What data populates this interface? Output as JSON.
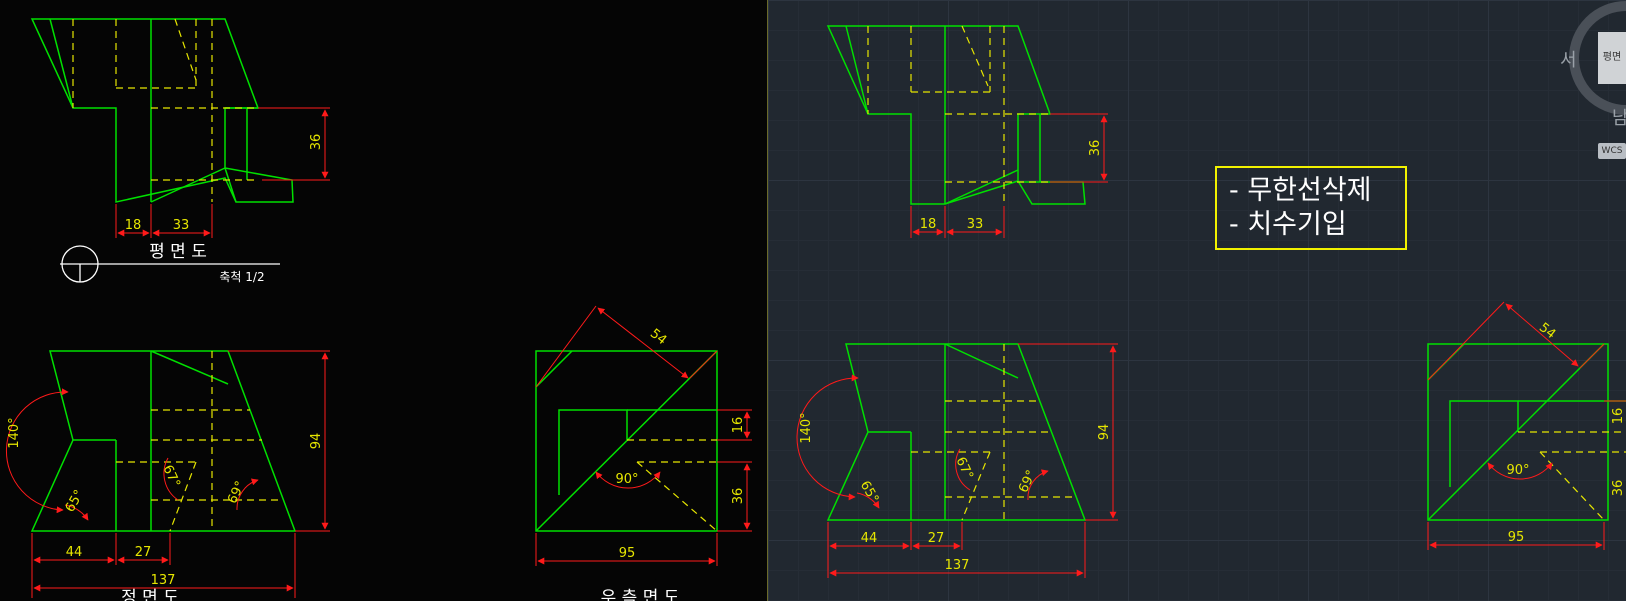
{
  "left_drawing": {
    "plan_title": "평 면 도",
    "plan_scale": "축척 1/2",
    "bottom_label_1": "정 면 도",
    "bottom_label_2": "우 측 면 도",
    "dims": {
      "plan_h": "36",
      "plan_w1": "18",
      "plan_w2": "33",
      "front_a1": "140°",
      "front_a2": "65°",
      "front_a3": "67°",
      "front_a4": "69°",
      "front_h": "94",
      "front_w1": "44",
      "front_w2": "27",
      "front_w3": "137",
      "side_diag": "54",
      "side_h1": "16",
      "side_h2": "36",
      "side_ang": "90°",
      "side_w": "95"
    }
  },
  "right_drawing": {
    "dims": {
      "plan_h": "36",
      "plan_w1": "18",
      "plan_w2": "33",
      "front_a1": "140°",
      "front_a2": "65°",
      "front_a3": "67°",
      "front_a4": "69°",
      "front_h": "94",
      "front_w1": "44",
      "front_w2": "27",
      "front_w3": "137",
      "side_diag": "54",
      "side_h1": "16",
      "side_h2": "36",
      "side_ang": "90°",
      "side_w": "95"
    }
  },
  "note": {
    "line1": "- 무한선삭제",
    "line2": "- 치수기입"
  },
  "viewcube": {
    "west": "서",
    "south": "남",
    "face": "평면",
    "wcs": "WCS"
  },
  "colors": {
    "object": "#00e000",
    "hidden": "#e6e600",
    "dimension": "#ff1a1a",
    "text": "#e6e600"
  }
}
